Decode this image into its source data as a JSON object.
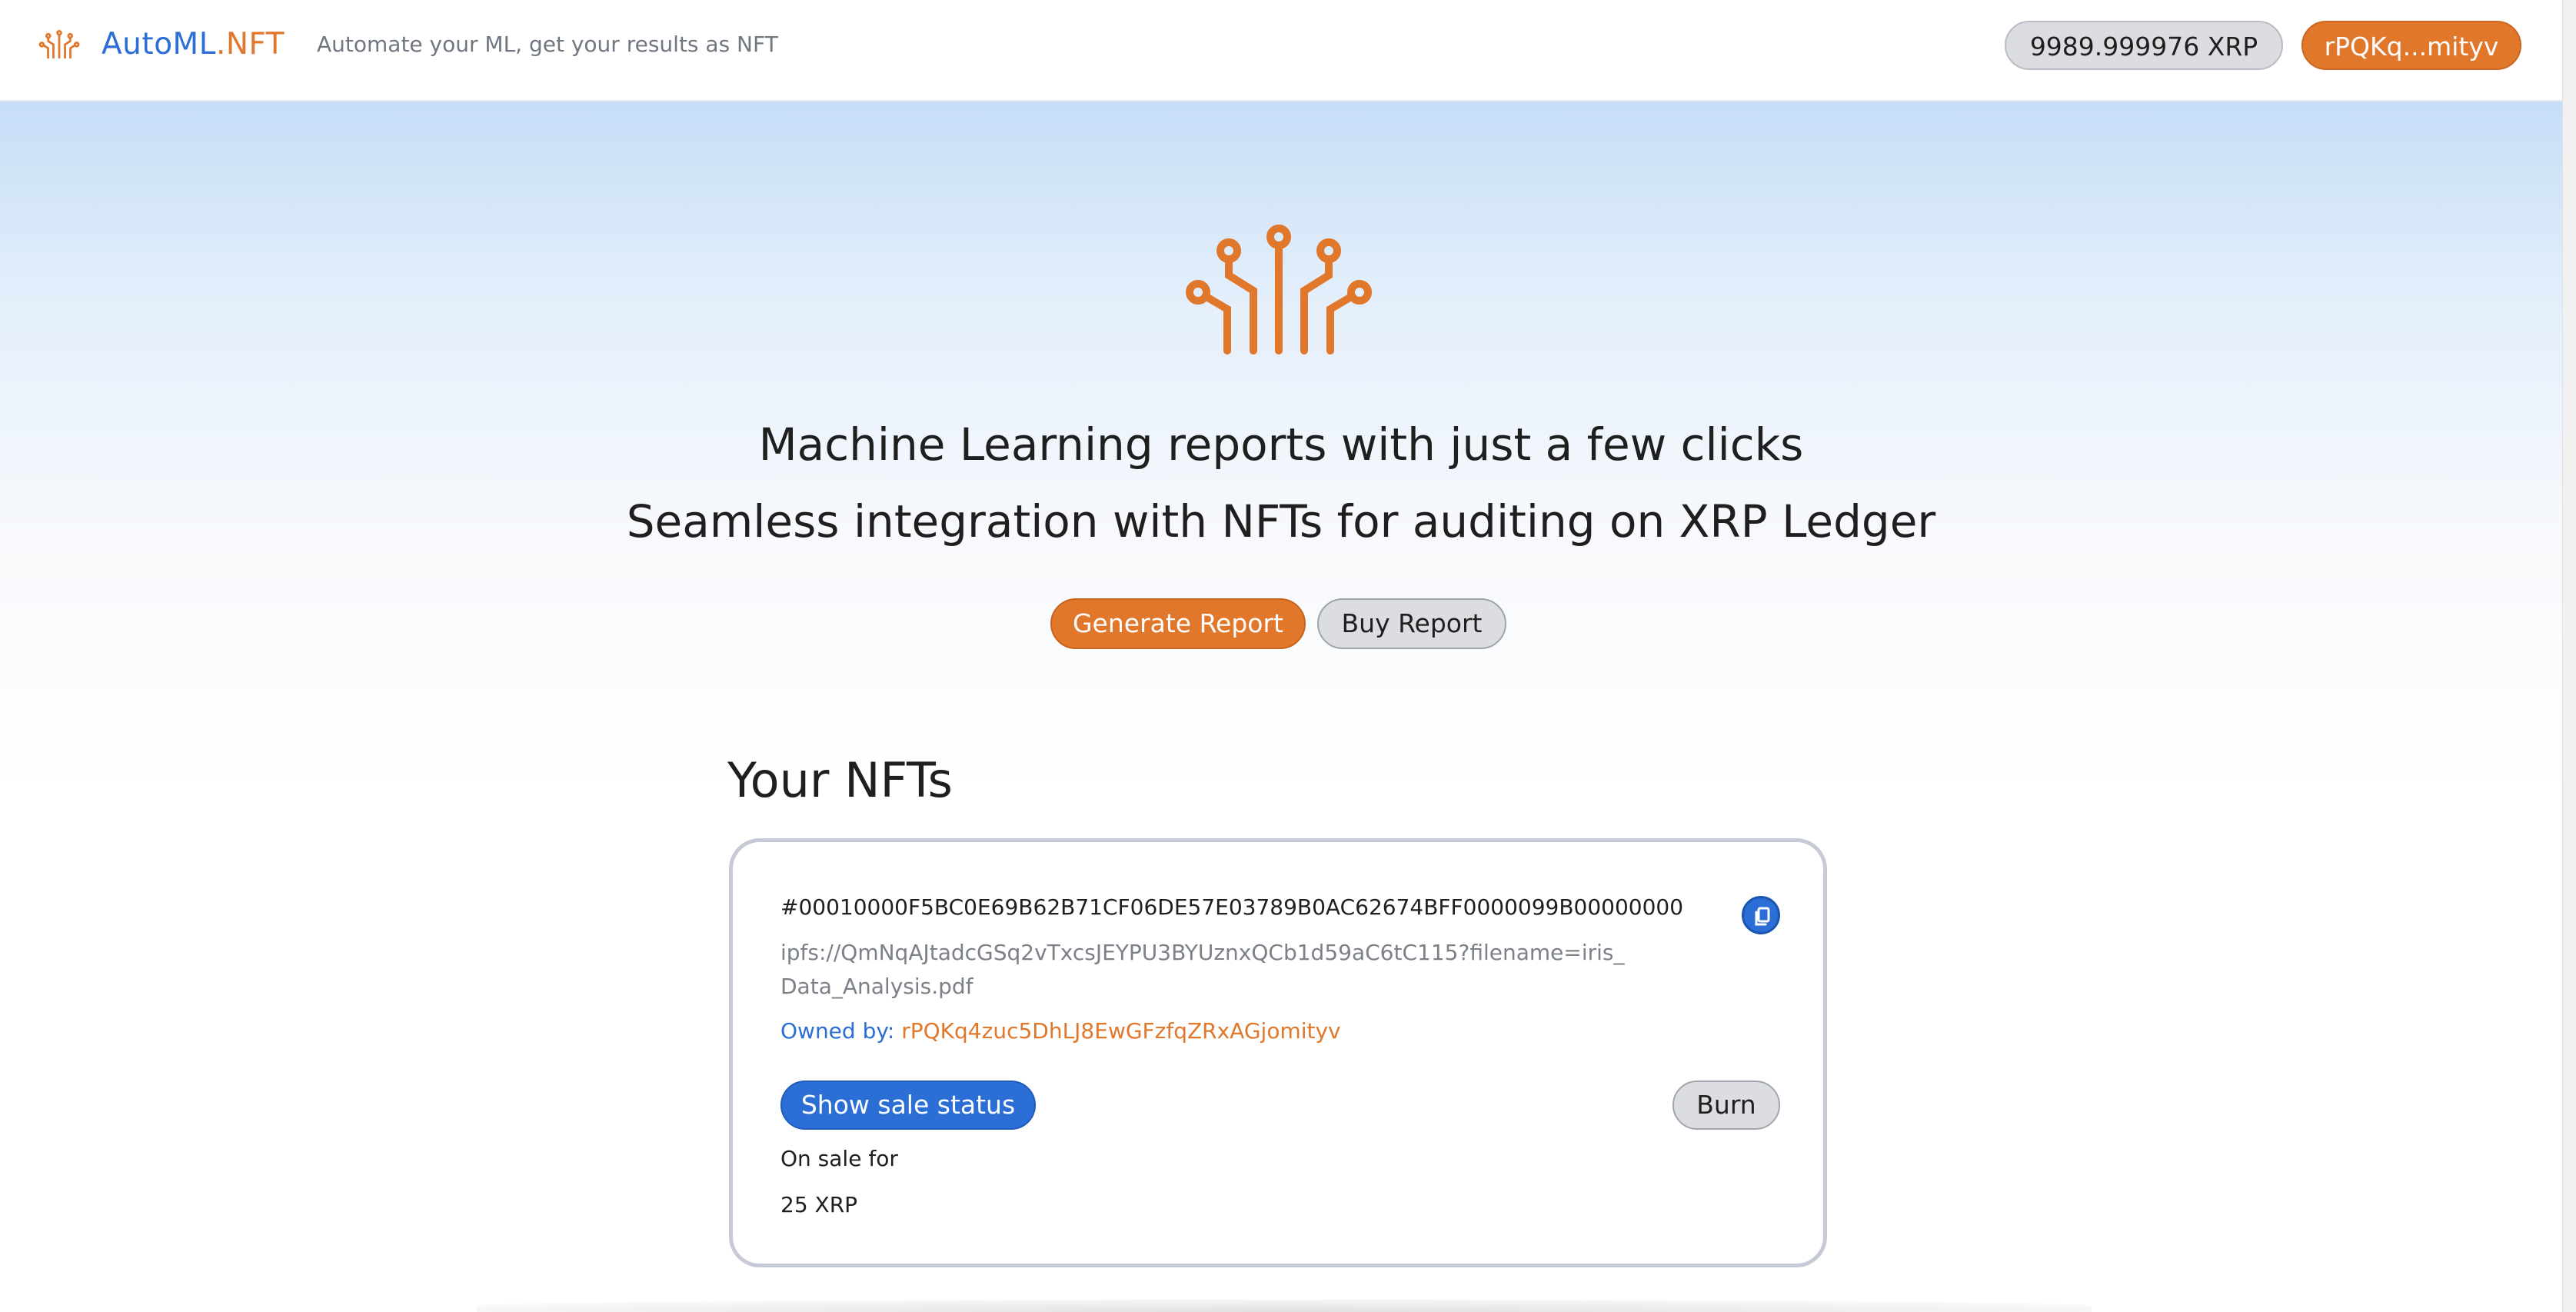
{
  "header": {
    "brand": {
      "part1": "AutoML",
      "part2": ".NFT"
    },
    "tagline": "Automate your ML, get your results as NFT",
    "balance": "9989.999976 XRP",
    "account": "rPQKq...mityv"
  },
  "hero": {
    "headline_1": "Machine Learning reports with just a few clicks",
    "headline_2": "Seamless integration with NFTs for auditing on XRP Ledger",
    "generate_label": "Generate Report",
    "buy_label": "Buy Report"
  },
  "nfts": {
    "title": "Your NFTs",
    "items": [
      {
        "id": "#00010000F5BC0E69B62B71CF06DE57E03789B0AC62674BFF0000099B00000000",
        "uri": "ipfs://QmNqAJtadcGSq2vTxcsJEYPU3BYUznxQCb1d59aC6tC115?filename=iris_Data_Analysis.pdf",
        "owner_label": "Owned by: ",
        "owner": "rPQKq4zuc5DhLJ8EwGFzfqZRxAGjomityv",
        "status_label": "Show sale status",
        "burn_label": "Burn",
        "sale_text": "On sale for",
        "sale_price": "25 XRP"
      }
    ]
  },
  "colors": {
    "brand_orange": "#e0772b",
    "brand_blue": "#2b6ed6",
    "neutral_pill": "#dcdde1"
  },
  "icons": {
    "brand": "circuit-tree-icon",
    "copy": "copy-icon"
  }
}
